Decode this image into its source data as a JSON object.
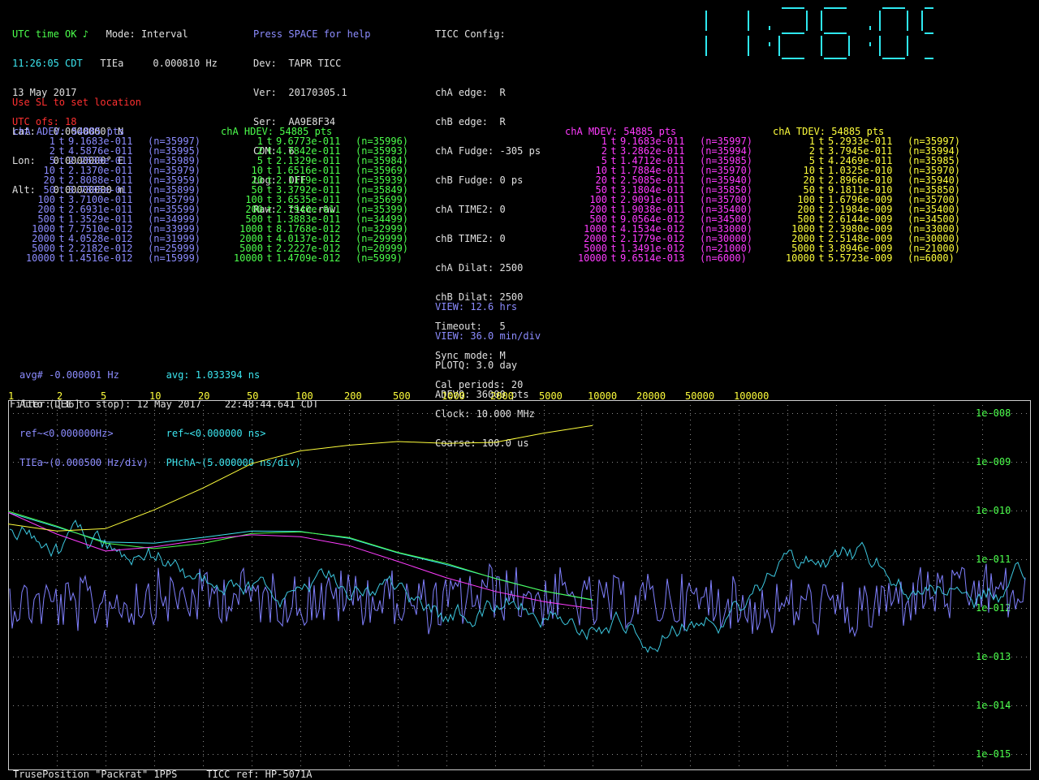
{
  "status": {
    "utc_time": "UTC time OK ♪",
    "mode_label": "Mode: Interval",
    "clock_line": "11:26:05 CDT",
    "tiea_label": "TIEa",
    "tiea_value": "0.000810 Hz",
    "date_line": "13 May 2017",
    "utc_ofs": "UTC ofs: 18"
  },
  "device": {
    "help": "Press SPACE for help",
    "lines": [
      "Dev:  TAPR TICC",
      "Ver:  20170305.1",
      "Ser:  AA9E8F34",
      "COM:  6",
      "Log:  OFF",
      "Raw:  ticc.raw"
    ]
  },
  "ticc_config": {
    "title": "TICC Config:",
    "lines": [
      "chA edge:  R",
      "chB edge:  R",
      "chA Fudge: -305 ps",
      "chB Fudge: 0 ps",
      "chA TIME2: 0",
      "chB TIME2: 0",
      "chA Dilat: 2500",
      "chB Dilat: 2500",
      "Timeout:   5",
      "Sync mode: M",
      "Cal periods: 20",
      "Clock: 10.000 MHz",
      "Coarse: 100.0 us"
    ]
  },
  "location": {
    "warning": "Use SL to set location",
    "lines": [
      "Lat:   0.0000000° N",
      "Lon:   0.0000000° E",
      "Alt:   0.00000000 m"
    ]
  },
  "big_clock": {
    "time": "11:26:05",
    "color": "#2ee8f0"
  },
  "tables": [
    {
      "title": "chA ADEV: 54885 pts",
      "rows": [
        {
          "tau": "1",
          "t": "t",
          "value": "9.1683e-011",
          "n": "(n=35997)"
        },
        {
          "tau": "2",
          "t": "t",
          "value": "4.5876e-011",
          "n": "(n=35995)"
        },
        {
          "tau": "5",
          "t": "t",
          "value": "2.2630e-011",
          "n": "(n=35989)"
        },
        {
          "tau": "10",
          "t": "t",
          "value": "2.1370e-011",
          "n": "(n=35979)"
        },
        {
          "tau": "20",
          "t": "t",
          "value": "2.8088e-011",
          "n": "(n=35959)"
        },
        {
          "tau": "50",
          "t": "t",
          "value": "3.7805e-011",
          "n": "(n=35899)"
        },
        {
          "tau": "100",
          "t": "t",
          "value": "3.7100e-011",
          "n": "(n=35799)"
        },
        {
          "tau": "200",
          "t": "t",
          "value": "2.6931e-011",
          "n": "(n=35599)"
        },
        {
          "tau": "500",
          "t": "t",
          "value": "1.3529e-011",
          "n": "(n=34999)"
        },
        {
          "tau": "1000",
          "t": "t",
          "value": "7.7510e-012",
          "n": "(n=33999)"
        },
        {
          "tau": "2000",
          "t": "t",
          "value": "4.0528e-012",
          "n": "(n=31999)"
        },
        {
          "tau": "5000",
          "t": "t",
          "value": "2.2182e-012",
          "n": "(n=25999)"
        },
        {
          "tau": "10000",
          "t": "t",
          "value": "1.4516e-012",
          "n": "(n=15999)"
        }
      ]
    },
    {
      "title": "chA HDEV: 54885 pts",
      "rows": [
        {
          "tau": "1",
          "t": "t",
          "value": "9.6773e-011",
          "n": "(n=35996)"
        },
        {
          "tau": "2",
          "t": "t",
          "value": "4.7842e-011",
          "n": "(n=35993)"
        },
        {
          "tau": "5",
          "t": "t",
          "value": "2.1329e-011",
          "n": "(n=35984)"
        },
        {
          "tau": "10",
          "t": "t",
          "value": "1.6516e-011",
          "n": "(n=35969)"
        },
        {
          "tau": "20",
          "t": "t",
          "value": "2.1119e-011",
          "n": "(n=35939)"
        },
        {
          "tau": "50",
          "t": "t",
          "value": "3.3792e-011",
          "n": "(n=35849)"
        },
        {
          "tau": "100",
          "t": "t",
          "value": "3.6535e-011",
          "n": "(n=35699)"
        },
        {
          "tau": "200",
          "t": "t",
          "value": "2.7940e-011",
          "n": "(n=35399)"
        },
        {
          "tau": "500",
          "t": "t",
          "value": "1.3883e-011",
          "n": "(n=34499)"
        },
        {
          "tau": "1000",
          "t": "t",
          "value": "8.1768e-012",
          "n": "(n=32999)"
        },
        {
          "tau": "2000",
          "t": "t",
          "value": "4.0137e-012",
          "n": "(n=29999)"
        },
        {
          "tau": "5000",
          "t": "t",
          "value": "2.2227e-012",
          "n": "(n=20999)"
        },
        {
          "tau": "10000",
          "t": "t",
          "value": "1.4709e-012",
          "n": "(n=5999)"
        }
      ]
    },
    {
      "title": "chA MDEV: 54885 pts",
      "rows": [
        {
          "tau": "1",
          "t": "t",
          "value": "9.1683e-011",
          "n": "(n=35997)"
        },
        {
          "tau": "2",
          "t": "t",
          "value": "3.2862e-011",
          "n": "(n=35994)"
        },
        {
          "tau": "5",
          "t": "t",
          "value": "1.4712e-011",
          "n": "(n=35985)"
        },
        {
          "tau": "10",
          "t": "t",
          "value": "1.7884e-011",
          "n": "(n=35970)"
        },
        {
          "tau": "20",
          "t": "t",
          "value": "2.5085e-011",
          "n": "(n=35940)"
        },
        {
          "tau": "50",
          "t": "t",
          "value": "3.1804e-011",
          "n": "(n=35850)"
        },
        {
          "tau": "100",
          "t": "t",
          "value": "2.9091e-011",
          "n": "(n=35700)"
        },
        {
          "tau": "200",
          "t": "t",
          "value": "1.9038e-011",
          "n": "(n=35400)"
        },
        {
          "tau": "500",
          "t": "t",
          "value": "9.0564e-012",
          "n": "(n=34500)"
        },
        {
          "tau": "1000",
          "t": "t",
          "value": "4.1534e-012",
          "n": "(n=33000)"
        },
        {
          "tau": "2000",
          "t": "t",
          "value": "2.1779e-012",
          "n": "(n=30000)"
        },
        {
          "tau": "5000",
          "t": "t",
          "value": "1.3491e-012",
          "n": "(n=21000)"
        },
        {
          "tau": "10000",
          "t": "t",
          "value": "9.6514e-013",
          "n": "(n=6000)"
        }
      ]
    },
    {
      "title": "chA TDEV: 54885 pts",
      "rows": [
        {
          "tau": "1",
          "t": "t",
          "value": "5.2933e-011",
          "n": "(n=35997)"
        },
        {
          "tau": "2",
          "t": "t",
          "value": "3.7945e-011",
          "n": "(n=35994)"
        },
        {
          "tau": "5",
          "t": "t",
          "value": "4.2469e-011",
          "n": "(n=35985)"
        },
        {
          "tau": "10",
          "t": "t",
          "value": "1.0325e-010",
          "n": "(n=35970)"
        },
        {
          "tau": "20",
          "t": "t",
          "value": "2.8966e-010",
          "n": "(n=35940)"
        },
        {
          "tau": "50",
          "t": "t",
          "value": "9.1811e-010",
          "n": "(n=35850)"
        },
        {
          "tau": "100",
          "t": "t",
          "value": "1.6796e-009",
          "n": "(n=35700)"
        },
        {
          "tau": "200",
          "t": "t",
          "value": "2.1984e-009",
          "n": "(n=35400)"
        },
        {
          "tau": "500",
          "t": "t",
          "value": "2.6144e-009",
          "n": "(n=34500)"
        },
        {
          "tau": "1000",
          "t": "t",
          "value": "2.3980e-009",
          "n": "(n=33000)"
        },
        {
          "tau": "2000",
          "t": "t",
          "value": "2.5148e-009",
          "n": "(n=30000)"
        },
        {
          "tau": "5000",
          "t": "t",
          "value": "3.8946e-009",
          "n": "(n=21000)"
        },
        {
          "tau": "10000",
          "t": "t",
          "value": "5.5723e-009",
          "n": "(n=6000)"
        }
      ]
    }
  ],
  "view": {
    "line1": "VIEW: 12.6 hrs",
    "line2": "VIEW: 36.0 min/div",
    "line3": "PLOTQ: 3.0 day",
    "line4": "ADEVQ: 36000 pts"
  },
  "stats": {
    "avg_hz": "avg# -0.000001 Hz",
    "avg_ns": "avg: 1.033394 ns",
    "auto_line": "Auto (DEL to stop): 12 May 2017    22:48:44.641 CDT",
    "ref_hz": "ref~<0.000000Hz>",
    "ref_ns": "ref~<0.000000 ns>",
    "tiea_div": "TIEa~(0.000500 Hz/div)",
    "phcha_div": "PHchA~(5.000000 ns/div)"
  },
  "filter_label": "Filter: [36]",
  "footer": {
    "left": "TrusePosition \"Packrat\" 1PPS",
    "right": "TICC ref: HP-5071A"
  },
  "chart_data": {
    "type": "line",
    "tau_axis_labels": [
      "1",
      "2",
      "5",
      "10",
      "20",
      "50",
      "100",
      "200",
      "500",
      "1000",
      "2000",
      "5000",
      "10000",
      "20000",
      "50000",
      "100000"
    ],
    "y_tick_labels": [
      "1e-008",
      "1e-009",
      "1e-010",
      "1e-011",
      "1e-012",
      "1e-013",
      "1e-014",
      "1e-015"
    ],
    "ylim": [
      1e-15,
      1e-08
    ],
    "tau": [
      1,
      2,
      5,
      10,
      20,
      50,
      100,
      200,
      500,
      1000,
      2000,
      5000,
      10000
    ],
    "series": [
      {
        "name": "chA ADEV",
        "color": "#3ce6f0",
        "values": [
          9.1683e-11,
          4.5876e-11,
          2.263e-11,
          2.137e-11,
          2.8088e-11,
          3.7805e-11,
          3.71e-11,
          2.6931e-11,
          1.3529e-11,
          7.751e-12,
          4.0528e-12,
          2.2182e-12,
          1.4516e-12
        ]
      },
      {
        "name": "chA HDEV",
        "color": "#4cff4c",
        "values": [
          9.6773e-11,
          4.7842e-11,
          2.1329e-11,
          1.6516e-11,
          2.1119e-11,
          3.3792e-11,
          3.6535e-11,
          2.794e-11,
          1.3883e-11,
          8.1768e-12,
          4.0137e-12,
          2.2227e-12,
          1.4709e-12
        ]
      },
      {
        "name": "chA MDEV",
        "color": "#ff3cff",
        "values": [
          9.1683e-11,
          3.2862e-11,
          1.4712e-11,
          1.7884e-11,
          2.5085e-11,
          3.1804e-11,
          2.9091e-11,
          1.9038e-11,
          9.0564e-12,
          4.1534e-12,
          2.1779e-12,
          1.3491e-12,
          9.6514e-13
        ]
      },
      {
        "name": "chA TDEV",
        "color": "#ffff3c",
        "values": [
          5.2933e-11,
          3.7945e-11,
          4.2469e-11,
          1.0325e-10,
          2.8966e-10,
          9.1811e-10,
          1.6796e-09,
          2.1984e-09,
          2.6144e-09,
          2.398e-09,
          2.5148e-09,
          3.8946e-09,
          5.5723e-09
        ]
      }
    ],
    "grid": true,
    "noise_traces": [
      {
        "name": "TIEa",
        "color": "#8080ff"
      },
      {
        "name": "PHchA",
        "color": "#3cc8e0"
      }
    ]
  }
}
